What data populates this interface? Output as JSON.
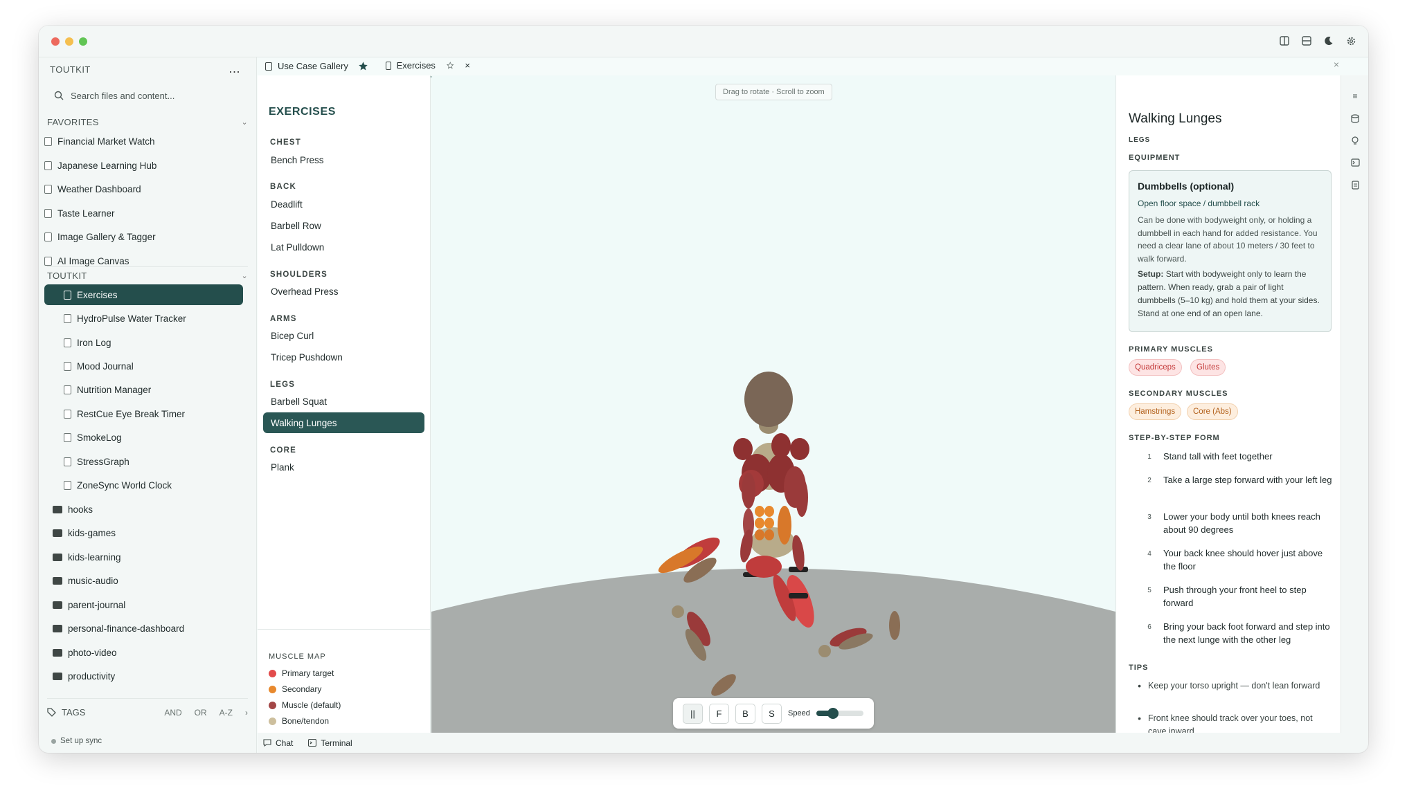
{
  "sidebar": {
    "workspace": "TOUTKIT",
    "more": "...",
    "search_placeholder": "Search files and content...",
    "favorites_label": "FAVORITES",
    "favorites": [
      "Financial Market Watch",
      "Japanese Learning Hub",
      "Weather Dashboard",
      "Taste Learner",
      "Image Gallery & Tagger",
      "AI Image Canvas"
    ],
    "project_label": "TOUTKIT",
    "project_items": [
      "Exercises",
      "HydroPulse Water Tracker",
      "Iron Log",
      "Mood Journal",
      "Nutrition Manager",
      "RestCue Eye Break Timer",
      "SmokeLog",
      "StressGraph",
      "ZoneSync World Clock"
    ],
    "folders": [
      "hooks",
      "kids-games",
      "kids-learning",
      "music-audio",
      "parent-journal",
      "personal-finance-dashboard",
      "photo-video",
      "productivity"
    ],
    "tags_label": "TAGS",
    "tags_and": "AND",
    "tags_or": "OR",
    "tags_sort": "A-Z",
    "sync": "Set up sync"
  },
  "tabs": [
    {
      "label": "Use Case Gallery",
      "starred": true
    },
    {
      "label": "Exercises",
      "active": true
    }
  ],
  "exercises": {
    "title": "EXERCISES",
    "categories": [
      {
        "name": "CHEST",
        "items": [
          "Bench Press"
        ]
      },
      {
        "name": "BACK",
        "items": [
          "Deadlift",
          "Barbell Row",
          "Lat Pulldown"
        ]
      },
      {
        "name": "SHOULDERS",
        "items": [
          "Overhead Press"
        ]
      },
      {
        "name": "ARMS",
        "items": [
          "Bicep Curl",
          "Tricep Pushdown"
        ]
      },
      {
        "name": "LEGS",
        "items": [
          "Barbell Squat",
          "Walking Lunges"
        ]
      },
      {
        "name": "CORE",
        "items": [
          "Plank"
        ]
      }
    ],
    "selected": "Walking Lunges",
    "legend_title": "MUSCLE MAP",
    "legend": [
      {
        "label": "Primary target",
        "color": "#e24b4b"
      },
      {
        "label": "Secondary",
        "color": "#e8892e"
      },
      {
        "label": "Muscle (default)",
        "color": "#a34646"
      },
      {
        "label": "Bone/tendon",
        "color": "#cdbf9d"
      }
    ]
  },
  "viewport": {
    "hint": "Drag to rotate · Scroll to zoom",
    "controls": [
      "||",
      "F",
      "B",
      "S"
    ],
    "speed_label": "Speed",
    "speed": 0.35
  },
  "bottom": {
    "chat": "Chat",
    "terminal": "Terminal"
  },
  "detail": {
    "title": "Walking Lunges",
    "category": "LEGS",
    "equipment_label": "EQUIPMENT",
    "equipment_name": "Dumbbells (optional)",
    "equipment_location": "Open floor space / dumbbell rack",
    "equipment_desc": "Can be done with bodyweight only, or holding a dumbbell in each hand for added resistance. You need a clear lane of about 10 meters / 30 feet to walk forward.",
    "setup_label": "Setup:",
    "setup_text": "Start with bodyweight only to learn the pattern. When ready, grab a pair of light dumbbells (5–10 kg) and hold them at your sides. Stand at one end of an open lane.",
    "primary_label": "PRIMARY MUSCLES",
    "primary": [
      "Quadriceps",
      "Glutes"
    ],
    "secondary_label": "SECONDARY MUSCLES",
    "secondary": [
      "Hamstrings",
      "Core (Abs)"
    ],
    "steps_label": "STEP-BY-STEP FORM",
    "steps": [
      "Stand tall with feet together",
      "Take a large step forward with your left leg",
      "Lower your body until both knees reach about 90 degrees",
      "Your back knee should hover just above the floor",
      "Push through your front heel to step forward",
      "Bring your back foot forward and step into the next lunge with the other leg"
    ],
    "tips_label": "TIPS",
    "tips": [
      "Keep your torso upright — don't lean forward",
      "Front knee should track over your toes, not cave inward"
    ]
  },
  "colors": {
    "accent": "#244e4c",
    "bg": "#f0faf9",
    "ground": "#a9adab"
  }
}
